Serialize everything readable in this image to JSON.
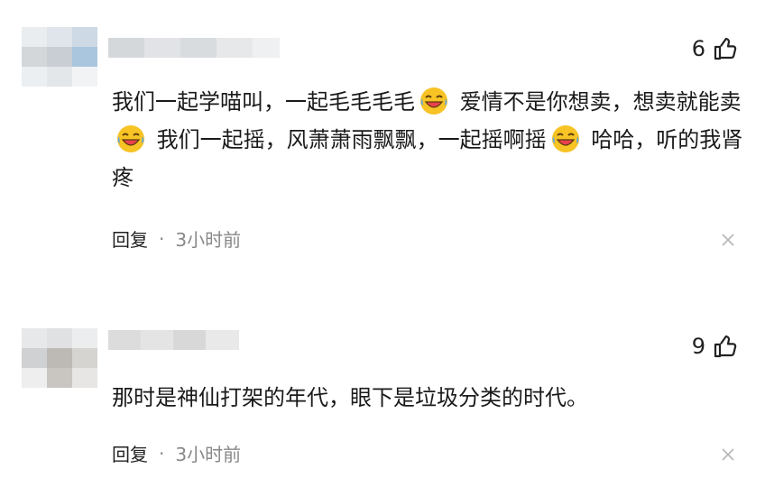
{
  "comments": [
    {
      "likes": "6",
      "text_segments": [
        "我们一起学喵叫，一起毛毛毛毛",
        " 爱情不是你想卖，想卖就能卖",
        " 我们一起摇，风萧萧雨飘飘，一起摇啊摇",
        " 哈哈，听的我肾疼"
      ],
      "emoji": "laughing-crying-emoji",
      "reply_label": "回复",
      "separator": "·",
      "time": "3小时前"
    },
    {
      "likes": "9",
      "text_segments": [
        "那时是神仙打架的年代，眼下是垃圾分类的时代。"
      ],
      "reply_label": "回复",
      "separator": "·",
      "time": "3小时前"
    }
  ],
  "colors": {
    "text": "#1a1a1a",
    "muted": "#888888",
    "emoji_yellow": "#f7c325",
    "emoji_red": "#e8424e"
  }
}
